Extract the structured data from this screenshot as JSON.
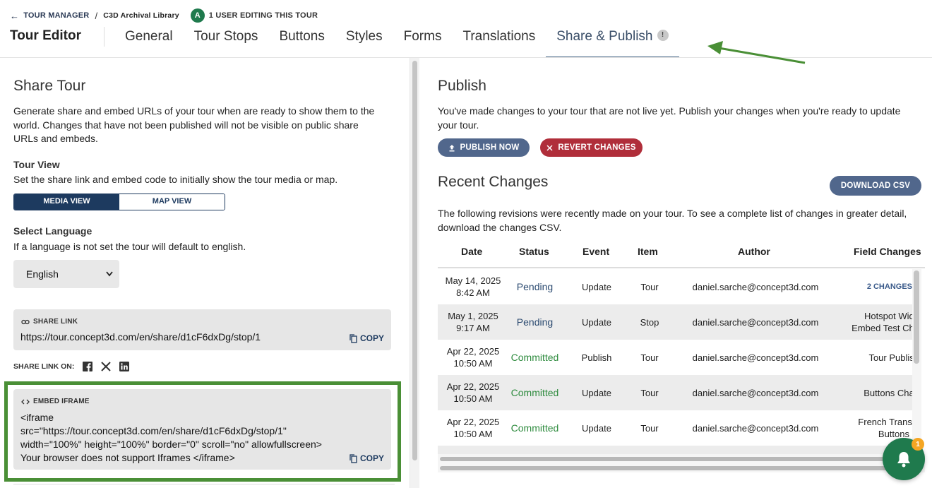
{
  "breadcrumb": {
    "back_label": "TOUR MANAGER",
    "separator": "/",
    "library": "C3D Archival Library",
    "editing_avatar": "A",
    "editing_text": "1 USER EDITING THIS TOUR"
  },
  "header": {
    "title": "Tour Editor",
    "tabs": [
      {
        "label": "General"
      },
      {
        "label": "Tour Stops"
      },
      {
        "label": "Buttons"
      },
      {
        "label": "Styles"
      },
      {
        "label": "Forms"
      },
      {
        "label": "Translations"
      },
      {
        "label": "Share & Publish",
        "badge": "!"
      }
    ],
    "active_tab": "Share & Publish"
  },
  "share": {
    "title": "Share Tour",
    "description": "Generate share and embed URLs of your tour when are ready to show them to the world. Changes that have not been published will not be visible on public share URLs and embeds.",
    "tour_view_label": "Tour View",
    "tour_view_desc": "Set the share link and embed code to initially show the tour media or map.",
    "media_view": "MEDIA VIEW",
    "map_view": "MAP VIEW",
    "language_label": "Select Language",
    "language_desc": "If a language is not set the tour will default to english.",
    "language_value": "English",
    "share_link_label": "SHARE LINK",
    "share_link_url": "https://tour.concept3d.com/en/share/d1cF6dxDg/stop/1",
    "copy_label": "COPY",
    "share_on_label": "SHARE LINK ON:",
    "embed_label": "EMBED IFRAME",
    "embed_lines": [
      "<iframe",
      "src=\"https://tour.concept3d.com/en/share/d1cF6dxDg/stop/1\"",
      "width=\"100%\" height=\"100%\" border=\"0\" scroll=\"no\" allowfullscreen>",
      "Your browser does not support Iframes </iframe>"
    ]
  },
  "publish": {
    "title": "Publish",
    "description": "You've made changes to your tour that are not live yet. Publish your changes when you're ready to update your tour.",
    "publish_now": "PUBLISH NOW",
    "revert_changes": "REVERT CHANGES",
    "recent_title": "Recent Changes",
    "download_csv": "DOWNLOAD CSV",
    "recent_desc": "The following revisions were recently made on your tour. To see a complete list of changes in greater detail, download the changes CSV.",
    "columns": [
      "Date",
      "Status",
      "Event",
      "Item",
      "Author",
      "Field Changes"
    ],
    "rows": [
      {
        "date1": "May 14, 2025",
        "date2": "8:42 AM",
        "status": "Pending",
        "event": "Update",
        "item": "Tour",
        "author": "daniel.sarche@concept3d.com",
        "fc1": "2 CHANGES",
        "fc2": ""
      },
      {
        "date1": "May 1, 2025",
        "date2": "9:17 AM",
        "status": "Pending",
        "event": "Update",
        "item": "Stop",
        "author": "daniel.sarche@concept3d.com",
        "fc1": "Hotspot Widg",
        "fc2": "Embed Test Cha"
      },
      {
        "date1": "Apr 22, 2025",
        "date2": "10:50 AM",
        "status": "Committed",
        "event": "Publish",
        "item": "Tour",
        "author": "daniel.sarche@concept3d.com",
        "fc1": "Tour Publish",
        "fc2": ""
      },
      {
        "date1": "Apr 22, 2025",
        "date2": "10:50 AM",
        "status": "Committed",
        "event": "Update",
        "item": "Tour",
        "author": "daniel.sarche@concept3d.com",
        "fc1": "Buttons Chan",
        "fc2": ""
      },
      {
        "date1": "Apr 22, 2025",
        "date2": "10:50 AM",
        "status": "Committed",
        "event": "Update",
        "item": "Tour",
        "author": "daniel.sarche@concept3d.com",
        "fc1": "French Transla",
        "fc2": "Buttons"
      }
    ]
  },
  "notifications": {
    "count": "1"
  },
  "colors": {
    "primary": "#1d3a5f",
    "publish_btn": "#51678c",
    "revert_btn": "#b02e3a",
    "green": "#1f7a4d",
    "highlight": "#4a8f36"
  }
}
